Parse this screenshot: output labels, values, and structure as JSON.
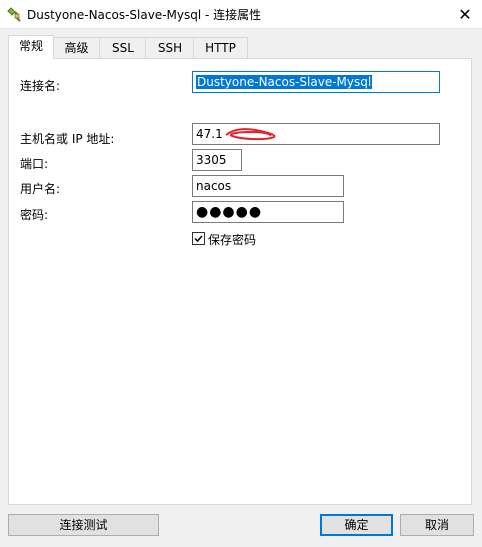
{
  "window": {
    "title": "Dustyone-Nacos-Slave-Mysql - 连接属性",
    "close_glyph": "✕",
    "app_icon": "plug-connection-icon"
  },
  "tabs": [
    {
      "label": "常规",
      "active": true
    },
    {
      "label": "高级",
      "active": false
    },
    {
      "label": "SSL",
      "active": false
    },
    {
      "label": "SSH",
      "active": false
    },
    {
      "label": "HTTP",
      "active": false
    }
  ],
  "form": {
    "connection_name_label": "连接名:",
    "connection_name_value": "Dustyone-Nacos-Slave-Mysql",
    "host_label": "主机名或 IP 地址:",
    "host_value": "47.1",
    "port_label": "端口:",
    "port_value": "3305",
    "user_label": "用户名:",
    "user_value": "nacos",
    "password_label": "密码:",
    "password_value": "●●●●●",
    "save_password_label": "保存密码",
    "save_password_checked": true
  },
  "buttons": {
    "test": "连接测试",
    "ok": "确定",
    "cancel": "取消"
  },
  "colors": {
    "accent": "#0078d7",
    "redaction": "#e3242b"
  }
}
